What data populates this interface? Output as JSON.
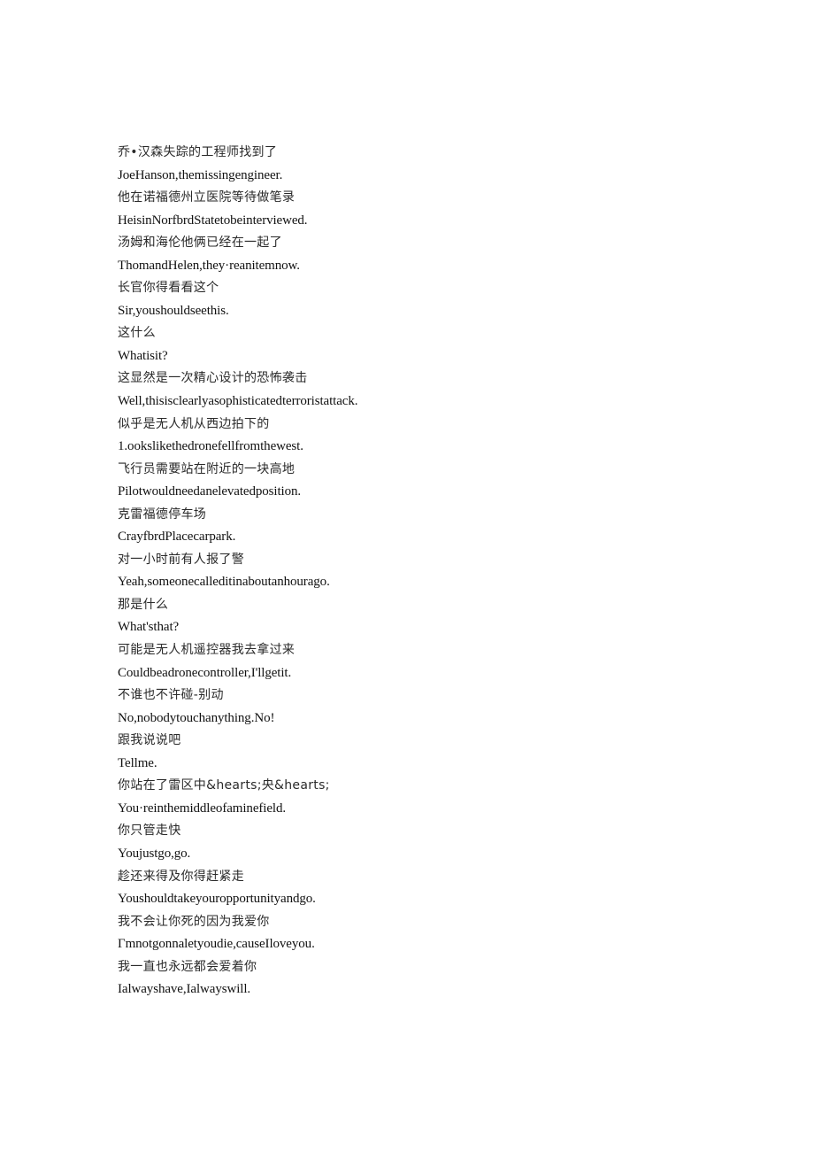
{
  "document": {
    "lines": [
      {
        "lang": "zh",
        "text": "乔•汉森失踪的工程师找到了"
      },
      {
        "lang": "en",
        "text": "JoeHanson,themissingengineer."
      },
      {
        "lang": "zh",
        "text": "他在诺福德州立医院等待做笔录"
      },
      {
        "lang": "en",
        "text": "HeisinNorfbrdStatetobeinterviewed."
      },
      {
        "lang": "zh",
        "text": "汤姆和海伦他俩已经在一起了"
      },
      {
        "lang": "en",
        "text": "ThomandHelen,they·reanitemnow."
      },
      {
        "lang": "zh",
        "text": "长官你得看看这个"
      },
      {
        "lang": "en",
        "text": "Sir,youshouldseethis."
      },
      {
        "lang": "zh",
        "text": "这什么"
      },
      {
        "lang": "en",
        "text": "Whatisit?"
      },
      {
        "lang": "zh",
        "text": "这显然是一次精心设计的恐怖袭击"
      },
      {
        "lang": "en",
        "text": "Well,thisisclearlyasophisticatedterroristattack."
      },
      {
        "lang": "zh",
        "text": "似乎是无人机从西边拍下的"
      },
      {
        "lang": "en",
        "text": "1.ookslikethedronefellfromthewest."
      },
      {
        "lang": "zh",
        "text": "飞行员需要站在附近的一块高地"
      },
      {
        "lang": "en",
        "text": "Pilotwouldneedanelevatedposition."
      },
      {
        "lang": "zh",
        "text": "克雷福德停车场"
      },
      {
        "lang": "en",
        "text": "CrayfbrdPlacecarpark."
      },
      {
        "lang": "zh",
        "text": "对一小时前有人报了警"
      },
      {
        "lang": "en",
        "text": "Yeah,someonecalleditinaboutanhourago."
      },
      {
        "lang": "zh",
        "text": "那是什么"
      },
      {
        "lang": "en",
        "text": "What'sthat?"
      },
      {
        "lang": "zh",
        "text": "可能是无人机遥控器我去拿过来"
      },
      {
        "lang": "en",
        "text": "Couldbeadronecontroller,I'llgetit."
      },
      {
        "lang": "zh",
        "text": "不谁也不许碰-别动"
      },
      {
        "lang": "en",
        "text": "No,nobodytouchanything.No!"
      },
      {
        "lang": "zh",
        "text": "跟我说说吧"
      },
      {
        "lang": "en",
        "text": "Tellme."
      },
      {
        "lang": "zh",
        "text": "你站在了雷区中&hearts;央&hearts;"
      },
      {
        "lang": "en",
        "text": "You·reinthemiddleofaminefield."
      },
      {
        "lang": "zh",
        "text": "你只管走快"
      },
      {
        "lang": "en",
        "text": "Youjustgo,go."
      },
      {
        "lang": "zh",
        "text": "趁还来得及你得赶紧走"
      },
      {
        "lang": "en",
        "text": "Youshouldtakeyouropportunityandgo."
      },
      {
        "lang": "zh",
        "text": "我不会让你死的因为我爱你"
      },
      {
        "lang": "en",
        "text": "Γmnotgonnaletyoudie,causeIloveyou."
      },
      {
        "lang": "zh",
        "text": "我一直也永远都会爱着你"
      },
      {
        "lang": "en",
        "text": "Ialwayshave,Ialwayswill."
      }
    ]
  }
}
